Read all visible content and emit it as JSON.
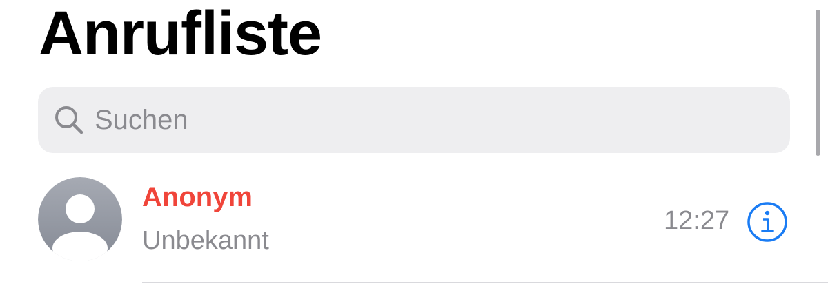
{
  "header": {
    "title": "Anrufliste"
  },
  "search": {
    "placeholder": "Suchen",
    "icon": "search-icon"
  },
  "calls": [
    {
      "name": "Anonym",
      "subtitle": "Unbekannt",
      "time": "12:27",
      "status": "missed",
      "avatar_icon": "person-icon",
      "action_icon": "info-icon"
    }
  ],
  "colors": {
    "missed_call": "#f0453a",
    "accent": "#1a7cf4",
    "secondary_text": "#8a8a8f",
    "search_background": "#eeeef0",
    "avatar_gradient_top": "#a6aab3",
    "avatar_gradient_bottom": "#858a95"
  }
}
